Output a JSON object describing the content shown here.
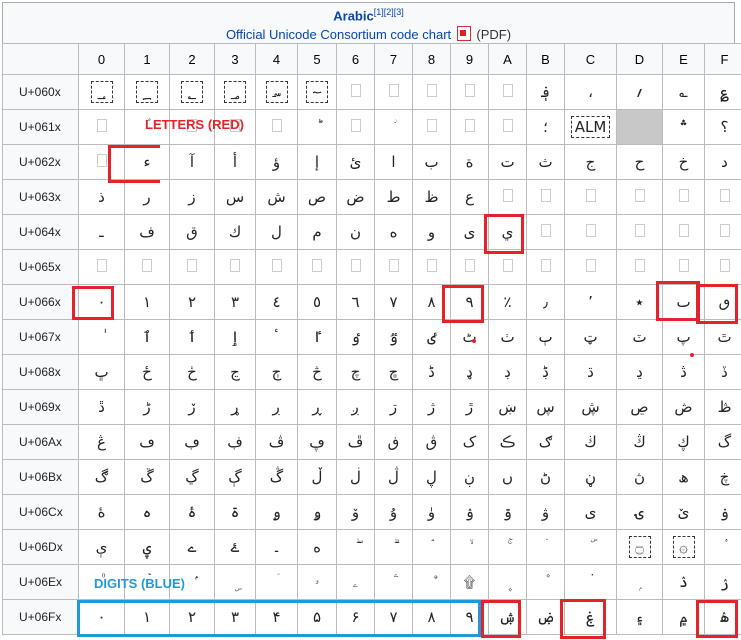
{
  "header": {
    "title": "Arabic",
    "title_refs": "[1][2][3]",
    "subtitle_link": "Official Unicode Consortium code chart",
    "subtitle_suffix": "(PDF)"
  },
  "columns": [
    "0",
    "1",
    "2",
    "3",
    "4",
    "5",
    "6",
    "7",
    "8",
    "9",
    "A",
    "B",
    "C",
    "D",
    "E",
    "F"
  ],
  "rows": [
    {
      "label": "U+060x",
      "cells": [
        "؀",
        "؁",
        "؂",
        "؃",
        "؄",
        "؅",
        "؆",
        "؇",
        "؈",
        "؉",
        "؊",
        "؋",
        "،",
        "؍",
        "؎",
        "؏"
      ]
    },
    {
      "label": "U+061x",
      "cells": [
        "ؐ",
        "ؑ",
        "ؒ",
        "ؓ",
        "ؔ",
        "ؕ",
        "ؖ",
        "ؗ",
        "ؘ",
        "ؙ",
        "ؚ",
        "؛",
        "ALM",
        "",
        "؞",
        "؟"
      ]
    },
    {
      "label": "U+062x",
      "cells": [
        "ؠ",
        "ء",
        "آ",
        "أ",
        "ؤ",
        "إ",
        "ئ",
        "ا",
        "ب",
        "ة",
        "ت",
        "ث",
        "ج",
        "ح",
        "خ",
        "د"
      ]
    },
    {
      "label": "U+063x",
      "cells": [
        "ذ",
        "ر",
        "ز",
        "س",
        "ش",
        "ص",
        "ض",
        "ط",
        "ظ",
        "ع",
        "غ",
        "ػ",
        "ؼ",
        "ؽ",
        "ؾ",
        "ؿ"
      ]
    },
    {
      "label": "U+064x",
      "cells": [
        "ـ",
        "ف",
        "ق",
        "ك",
        "ل",
        "م",
        "ن",
        "ه",
        "و",
        "ى",
        "ي",
        "ً",
        "ٌ",
        "ٍ",
        "َ",
        "ُ"
      ]
    },
    {
      "label": "U+065x",
      "cells": [
        "ِ",
        "ّ",
        "ْ",
        "ٓ",
        "ٔ",
        "ٕ",
        "ٖ",
        "ٗ",
        "٘",
        "ٙ",
        "ٚ",
        "ٛ",
        "ٜ",
        "ٝ",
        "ٞ",
        "ٟ"
      ]
    },
    {
      "label": "U+066x",
      "cells": [
        "٠",
        "١",
        "٢",
        "٣",
        "٤",
        "٥",
        "٦",
        "٧",
        "٨",
        "٩",
        "٪",
        "٫",
        "٬",
        "٭",
        "ٮ",
        "ٯ"
      ]
    },
    {
      "label": "U+067x",
      "cells": [
        "ٰ",
        "ٱ",
        "ٲ",
        "ٳ",
        "ٴ",
        "ٵ",
        "ٶ",
        "ٷ",
        "ٸ",
        "ٹ",
        "ٺ",
        "ٻ",
        "ټ",
        "ٽ",
        "پ",
        "ٿ"
      ]
    },
    {
      "label": "U+068x",
      "cells": [
        "ڀ",
        "ځ",
        "ڂ",
        "ڃ",
        "ڄ",
        "څ",
        "چ",
        "ڇ",
        "ڈ",
        "ډ",
        "ڊ",
        "ڋ",
        "ڌ",
        "ڍ",
        "ڎ",
        "ڏ"
      ]
    },
    {
      "label": "U+069x",
      "cells": [
        "ڐ",
        "ڑ",
        "ڒ",
        "ړ",
        "ڔ",
        "ڕ",
        "ږ",
        "ڗ",
        "ژ",
        "ڙ",
        "ښ",
        "ڛ",
        "ڜ",
        "ڝ",
        "ڞ",
        "ڟ"
      ]
    },
    {
      "label": "U+06Ax",
      "cells": [
        "ڠ",
        "ڡ",
        "ڢ",
        "ڣ",
        "ڤ",
        "ڥ",
        "ڦ",
        "ڧ",
        "ڨ",
        "ک",
        "ڪ",
        "ګ",
        "ڬ",
        "ڭ",
        "ڮ",
        "گ"
      ]
    },
    {
      "label": "U+06Bx",
      "cells": [
        "ڰ",
        "ڱ",
        "ڲ",
        "ڳ",
        "ڴ",
        "ڵ",
        "ڶ",
        "ڷ",
        "ڸ",
        "ڹ",
        "ں",
        "ڻ",
        "ڼ",
        "ڽ",
        "ھ",
        "ڿ"
      ]
    },
    {
      "label": "U+06Cx",
      "cells": [
        "ۀ",
        "ہ",
        "ۂ",
        "ۃ",
        "ۄ",
        "ۅ",
        "ۆ",
        "ۇ",
        "ۈ",
        "ۉ",
        "ۊ",
        "ۋ",
        "ی",
        "ۍ",
        "ێ",
        "ۏ"
      ]
    },
    {
      "label": "U+06Dx",
      "cells": [
        "ې",
        "ۑ",
        "ے",
        "ۓ",
        "۔",
        "ە",
        "ۖ",
        "ۗ",
        "ۘ",
        "ۙ",
        "ۚ",
        "ۛ",
        "ۜ",
        "۝",
        "۞",
        "۟"
      ]
    },
    {
      "label": "U+06Ex",
      "cells": [
        "۠",
        "ۡ",
        "ۢ",
        "ۣ",
        "ۤ",
        "ۥ",
        "ۦ",
        "ۧ",
        "ۨ",
        "۩",
        "۪",
        "۫",
        "۬",
        "ۭ",
        "ۮ",
        "ۯ"
      ]
    },
    {
      "label": "U+06Fx",
      "cells": [
        "۰",
        "۱",
        "۲",
        "۳",
        "۴",
        "۵",
        "۶",
        "۷",
        "۸",
        "۹",
        "ۺ",
        "ۻ",
        "ۼ",
        "۽",
        "۾",
        "ۿ"
      ]
    }
  ],
  "dashed_cells": [
    "0-0",
    "0-1",
    "0-2",
    "0-3",
    "0-4",
    "0-5",
    "1-12",
    "13-13",
    "13-14"
  ],
  "tofu_cells": [
    "0-6",
    "0-7",
    "0-8",
    "0-9",
    "0-10",
    "1-0",
    "1-2",
    "1-3",
    "1-4",
    "1-6",
    "1-8",
    "1-9",
    "1-10",
    "1-13",
    "2-0",
    "3-10",
    "3-11",
    "3-12",
    "3-13",
    "3-14",
    "3-15",
    "4-11",
    "4-12",
    "4-13",
    "4-14",
    "4-15",
    "5-0",
    "5-1",
    "5-2",
    "5-3",
    "5-4",
    "5-5",
    "5-6",
    "5-7",
    "5-8",
    "5-9",
    "5-10",
    "5-11",
    "5-12",
    "5-13",
    "5-14",
    "5-15"
  ],
  "empty_cells": [
    "1-13"
  ],
  "annotations": {
    "letters_label": "LETTERS (RED)",
    "digits_label": "DIGITS (BLUE)",
    "letters_color": "#e3222a",
    "digits_color": "#1f9ad6"
  }
}
